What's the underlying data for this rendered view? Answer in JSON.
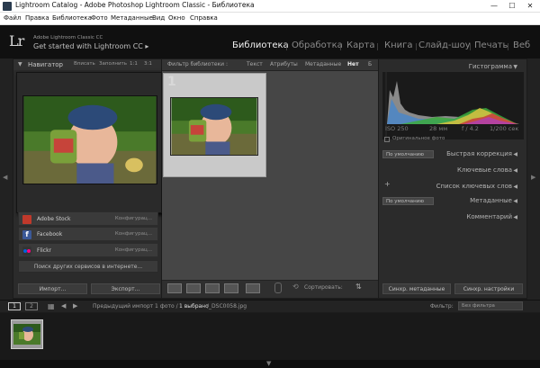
{
  "window": {
    "title": "Lightroom Catalog - Adobe Photoshop Lightroom Classic - Библиотека",
    "minimize": "—",
    "maximize": "☐",
    "close": "✕"
  },
  "menu": [
    "Файл",
    "Правка",
    "Библиотека",
    "Фото",
    "Метаданные",
    "Вид",
    "Окно",
    "Справка"
  ],
  "identity": {
    "logo": "Lr",
    "product": "Adobe Lightroom Classic CC",
    "cta": "Get started with Lightroom CC ▸"
  },
  "modules": [
    "Библиотека",
    "Обработка",
    "Карта",
    "Книга",
    "Слайд-шоу",
    "Печать",
    "Веб"
  ],
  "navigator": {
    "title": "Навигатор",
    "zoom_options": [
      "Вписать",
      "Заполнить",
      "1:1",
      "3:1"
    ]
  },
  "publish_services": [
    {
      "name": "Adobe Stock",
      "action": "Конфигурац...",
      "icon_color": "#c0392b"
    },
    {
      "name": "Facebook",
      "action": "Конфигурац...",
      "icon_color": "#3b5998"
    },
    {
      "name": "Flickr",
      "action": "Конфигурац...",
      "icon_color": "#cc1166"
    }
  ],
  "more_services": "Поиск других сервисов в интернете...",
  "buttons": {
    "import": "Импорт...",
    "export": "Экспорт..."
  },
  "filter_bar": {
    "title": "Фильтр библиотеки :",
    "tabs": [
      "Текст",
      "Атрибуты",
      "Метаданные",
      "Нет"
    ],
    "active": "Нет",
    "overflow": "Б"
  },
  "grid": {
    "cell_index": "1"
  },
  "toolbar": {
    "sort_label": "Сортировать:"
  },
  "histogram": {
    "title": "Гистограмма",
    "iso": "ISO 250",
    "focal": "28 мм",
    "aperture": "f / 4.2",
    "shutter": "1/200 сек",
    "original_photo": "Оригинальное фото"
  },
  "right_panels": {
    "quick_develop": "Быстрая коррекция",
    "preset_default": "По умолчанию",
    "keywording": "Ключевые слова",
    "keyword_list": "Список ключевых слов",
    "metadata": "Метаданные",
    "metadata_default": "По умолчанию",
    "comments": "Комментарий"
  },
  "sync": {
    "metadata": "Синхр. метаданные",
    "settings": "Синхр. настройки"
  },
  "filmstrip": {
    "page1": "1",
    "page2": "2",
    "source": "Предыдущий импорт",
    "count": "1 фото /",
    "selected": "1 выбрано",
    "filename": "/_DSC0058.jpg",
    "filter_label": "Фильтр:",
    "filter_value": "Без фильтра"
  },
  "colors": {
    "accent": "#f2f2f2",
    "panel": "#2b2b2b",
    "center": "#464646"
  }
}
